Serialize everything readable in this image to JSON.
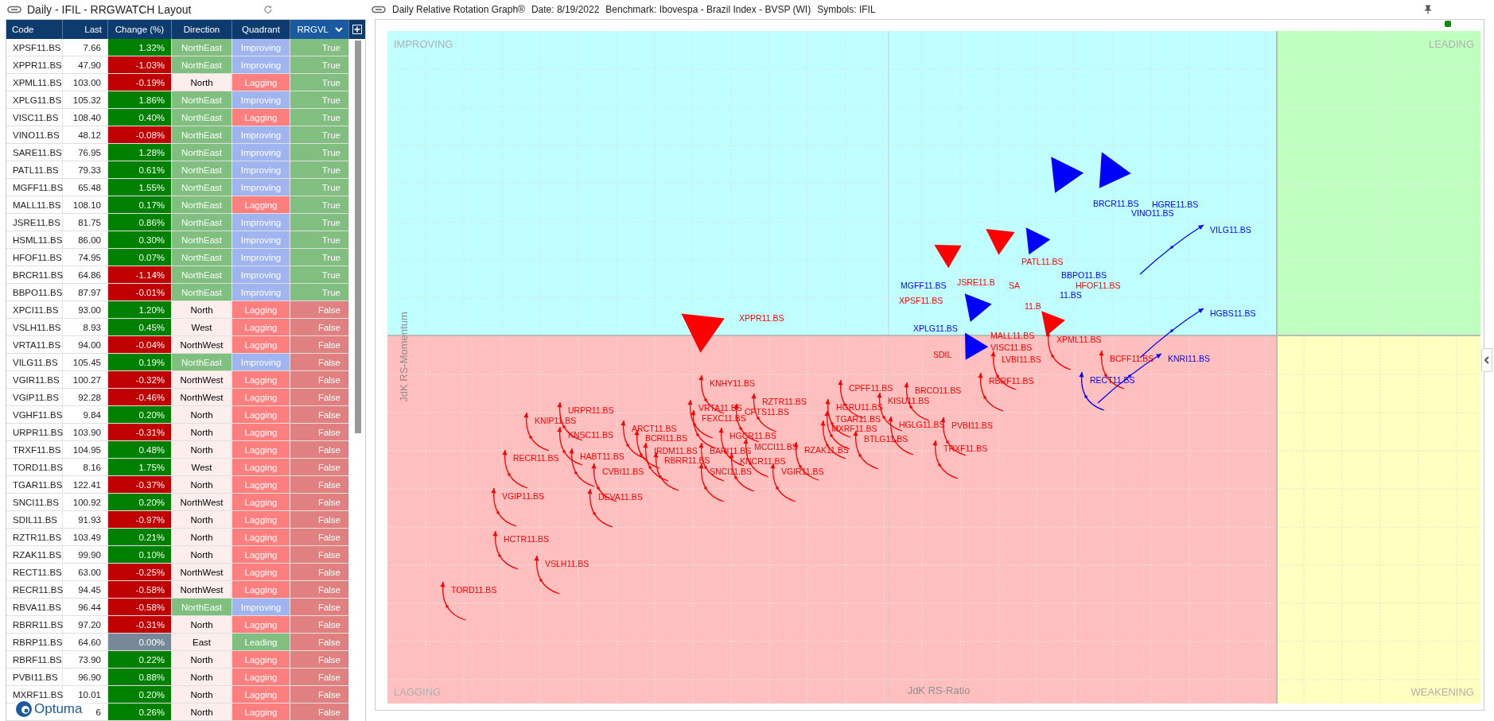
{
  "watchlist": {
    "title": "Daily - IFIL - RRGWATCH Layout",
    "columns": [
      "Code",
      "Last",
      "Change (%)",
      "Direction",
      "Quadrant",
      "RRGVL"
    ],
    "rows": [
      {
        "code": "XPSF11.BS",
        "last": "7.66",
        "change": {
          "text": "1.32%",
          "color": "#008000"
        },
        "direction": {
          "text": "NorthEast",
          "color": "#80bf80"
        },
        "quadrant": {
          "text": "Improving",
          "color": "#a0b4f0"
        },
        "rrgvl": {
          "text": "True",
          "color": "#80bf80"
        }
      },
      {
        "code": "XPPR11.BS",
        "last": "47.90",
        "change": {
          "text": "-1.03%",
          "color": "#c00000"
        },
        "direction": {
          "text": "NorthEast",
          "color": "#80bf80"
        },
        "quadrant": {
          "text": "Improving",
          "color": "#a0b4f0"
        },
        "rrgvl": {
          "text": "True",
          "color": "#80bf80"
        }
      },
      {
        "code": "XPML11.BS",
        "last": "103.00",
        "change": {
          "text": "-0.19%",
          "color": "#c00000"
        },
        "direction": {
          "text": "North",
          "color": "#fdeeee"
        },
        "quadrant": {
          "text": "Lagging",
          "color": "#ff7f7f"
        },
        "rrgvl": {
          "text": "True",
          "color": "#80bf80"
        }
      },
      {
        "code": "XPLG11.BS",
        "last": "105.32",
        "change": {
          "text": "1.86%",
          "color": "#008000"
        },
        "direction": {
          "text": "NorthEast",
          "color": "#80bf80"
        },
        "quadrant": {
          "text": "Improving",
          "color": "#a0b4f0"
        },
        "rrgvl": {
          "text": "True",
          "color": "#80bf80"
        }
      },
      {
        "code": "VISC11.BS",
        "last": "108.40",
        "change": {
          "text": "0.40%",
          "color": "#008000"
        },
        "direction": {
          "text": "NorthEast",
          "color": "#80bf80"
        },
        "quadrant": {
          "text": "Lagging",
          "color": "#ff7f7f"
        },
        "rrgvl": {
          "text": "True",
          "color": "#80bf80"
        }
      },
      {
        "code": "VINO11.BS",
        "last": "48.12",
        "change": {
          "text": "-0.08%",
          "color": "#c00000"
        },
        "direction": {
          "text": "NorthEast",
          "color": "#80bf80"
        },
        "quadrant": {
          "text": "Improving",
          "color": "#a0b4f0"
        },
        "rrgvl": {
          "text": "True",
          "color": "#80bf80"
        }
      },
      {
        "code": "SARE11.BS",
        "last": "76.95",
        "change": {
          "text": "1.28%",
          "color": "#008000"
        },
        "direction": {
          "text": "NorthEast",
          "color": "#80bf80"
        },
        "quadrant": {
          "text": "Improving",
          "color": "#a0b4f0"
        },
        "rrgvl": {
          "text": "True",
          "color": "#80bf80"
        }
      },
      {
        "code": "PATL11.BS",
        "last": "79.33",
        "change": {
          "text": "0.61%",
          "color": "#008000"
        },
        "direction": {
          "text": "NorthEast",
          "color": "#80bf80"
        },
        "quadrant": {
          "text": "Improving",
          "color": "#a0b4f0"
        },
        "rrgvl": {
          "text": "True",
          "color": "#80bf80"
        }
      },
      {
        "code": "MGFF11.BS",
        "last": "65.48",
        "change": {
          "text": "1.55%",
          "color": "#008000"
        },
        "direction": {
          "text": "NorthEast",
          "color": "#80bf80"
        },
        "quadrant": {
          "text": "Improving",
          "color": "#a0b4f0"
        },
        "rrgvl": {
          "text": "True",
          "color": "#80bf80"
        }
      },
      {
        "code": "MALL11.BS",
        "last": "108.10",
        "change": {
          "text": "0.17%",
          "color": "#008000"
        },
        "direction": {
          "text": "NorthEast",
          "color": "#80bf80"
        },
        "quadrant": {
          "text": "Lagging",
          "color": "#ff7f7f"
        },
        "rrgvl": {
          "text": "True",
          "color": "#80bf80"
        }
      },
      {
        "code": "JSRE11.BS",
        "last": "81.75",
        "change": {
          "text": "0.86%",
          "color": "#008000"
        },
        "direction": {
          "text": "NorthEast",
          "color": "#80bf80"
        },
        "quadrant": {
          "text": "Improving",
          "color": "#a0b4f0"
        },
        "rrgvl": {
          "text": "True",
          "color": "#80bf80"
        }
      },
      {
        "code": "HSML11.BS",
        "last": "86.00",
        "change": {
          "text": "0.30%",
          "color": "#008000"
        },
        "direction": {
          "text": "NorthEast",
          "color": "#80bf80"
        },
        "quadrant": {
          "text": "Improving",
          "color": "#a0b4f0"
        },
        "rrgvl": {
          "text": "True",
          "color": "#80bf80"
        }
      },
      {
        "code": "HFOF11.BS",
        "last": "74.95",
        "change": {
          "text": "0.07%",
          "color": "#008000"
        },
        "direction": {
          "text": "NorthEast",
          "color": "#80bf80"
        },
        "quadrant": {
          "text": "Improving",
          "color": "#a0b4f0"
        },
        "rrgvl": {
          "text": "True",
          "color": "#80bf80"
        }
      },
      {
        "code": "BRCR11.BS",
        "last": "64.86",
        "change": {
          "text": "-1.14%",
          "color": "#c00000"
        },
        "direction": {
          "text": "NorthEast",
          "color": "#80bf80"
        },
        "quadrant": {
          "text": "Improving",
          "color": "#a0b4f0"
        },
        "rrgvl": {
          "text": "True",
          "color": "#80bf80"
        }
      },
      {
        "code": "BBPO11.BS",
        "last": "87.97",
        "change": {
          "text": "-0.01%",
          "color": "#c00000"
        },
        "direction": {
          "text": "NorthEast",
          "color": "#80bf80"
        },
        "quadrant": {
          "text": "Improving",
          "color": "#a0b4f0"
        },
        "rrgvl": {
          "text": "True",
          "color": "#80bf80"
        }
      },
      {
        "code": "XPCI11.BS",
        "last": "93.00",
        "change": {
          "text": "1.20%",
          "color": "#008000"
        },
        "direction": {
          "text": "North",
          "color": "#fdeeee"
        },
        "quadrant": {
          "text": "Lagging",
          "color": "#ff7f7f"
        },
        "rrgvl": {
          "text": "False",
          "color": "#e08080"
        }
      },
      {
        "code": "VSLH11.BS",
        "last": "8.93",
        "change": {
          "text": "0.45%",
          "color": "#008000"
        },
        "direction": {
          "text": "West",
          "color": "#fdeeee"
        },
        "quadrant": {
          "text": "Lagging",
          "color": "#ff7f7f"
        },
        "rrgvl": {
          "text": "False",
          "color": "#e08080"
        }
      },
      {
        "code": "VRTA11.BS",
        "last": "94.00",
        "change": {
          "text": "-0.04%",
          "color": "#c00000"
        },
        "direction": {
          "text": "NorthWest",
          "color": "#fdeeee"
        },
        "quadrant": {
          "text": "Lagging",
          "color": "#ff7f7f"
        },
        "rrgvl": {
          "text": "False",
          "color": "#e08080"
        }
      },
      {
        "code": "VILG11.BS",
        "last": "105.45",
        "change": {
          "text": "0.19%",
          "color": "#008000"
        },
        "direction": {
          "text": "NorthEast",
          "color": "#80bf80"
        },
        "quadrant": {
          "text": "Improving",
          "color": "#a0b4f0"
        },
        "rrgvl": {
          "text": "False",
          "color": "#e08080"
        }
      },
      {
        "code": "VGIR11.BS",
        "last": "100.27",
        "change": {
          "text": "-0.32%",
          "color": "#c00000"
        },
        "direction": {
          "text": "NorthWest",
          "color": "#fdeeee"
        },
        "quadrant": {
          "text": "Lagging",
          "color": "#ff7f7f"
        },
        "rrgvl": {
          "text": "False",
          "color": "#e08080"
        }
      },
      {
        "code": "VGIP11.BS",
        "last": "92.28",
        "change": {
          "text": "-0.46%",
          "color": "#c00000"
        },
        "direction": {
          "text": "NorthWest",
          "color": "#fdeeee"
        },
        "quadrant": {
          "text": "Lagging",
          "color": "#ff7f7f"
        },
        "rrgvl": {
          "text": "False",
          "color": "#e08080"
        }
      },
      {
        "code": "VGHF11.BS",
        "last": "9.84",
        "change": {
          "text": "0.20%",
          "color": "#008000"
        },
        "direction": {
          "text": "North",
          "color": "#fdeeee"
        },
        "quadrant": {
          "text": "Lagging",
          "color": "#ff7f7f"
        },
        "rrgvl": {
          "text": "False",
          "color": "#e08080"
        }
      },
      {
        "code": "URPR11.BS",
        "last": "103.90",
        "change": {
          "text": "-0.31%",
          "color": "#c00000"
        },
        "direction": {
          "text": "North",
          "color": "#fdeeee"
        },
        "quadrant": {
          "text": "Lagging",
          "color": "#ff7f7f"
        },
        "rrgvl": {
          "text": "False",
          "color": "#e08080"
        }
      },
      {
        "code": "TRXF11.BS",
        "last": "104.95",
        "change": {
          "text": "0.48%",
          "color": "#008000"
        },
        "direction": {
          "text": "North",
          "color": "#fdeeee"
        },
        "quadrant": {
          "text": "Lagging",
          "color": "#ff7f7f"
        },
        "rrgvl": {
          "text": "False",
          "color": "#e08080"
        }
      },
      {
        "code": "TORD11.BS",
        "last": "8.16",
        "change": {
          "text": "1.75%",
          "color": "#008000"
        },
        "direction": {
          "text": "West",
          "color": "#fdeeee"
        },
        "quadrant": {
          "text": "Lagging",
          "color": "#ff7f7f"
        },
        "rrgvl": {
          "text": "False",
          "color": "#e08080"
        }
      },
      {
        "code": "TGAR11.BS",
        "last": "122.41",
        "change": {
          "text": "-0.37%",
          "color": "#c00000"
        },
        "direction": {
          "text": "North",
          "color": "#fdeeee"
        },
        "quadrant": {
          "text": "Lagging",
          "color": "#ff7f7f"
        },
        "rrgvl": {
          "text": "False",
          "color": "#e08080"
        }
      },
      {
        "code": "SNCI11.BS",
        "last": "100.92",
        "change": {
          "text": "0.20%",
          "color": "#008000"
        },
        "direction": {
          "text": "NorthWest",
          "color": "#fdeeee"
        },
        "quadrant": {
          "text": "Lagging",
          "color": "#ff7f7f"
        },
        "rrgvl": {
          "text": "False",
          "color": "#e08080"
        }
      },
      {
        "code": "SDIL11.BS",
        "last": "91.93",
        "change": {
          "text": "-0.97%",
          "color": "#c00000"
        },
        "direction": {
          "text": "North",
          "color": "#fdeeee"
        },
        "quadrant": {
          "text": "Lagging",
          "color": "#ff7f7f"
        },
        "rrgvl": {
          "text": "False",
          "color": "#e08080"
        }
      },
      {
        "code": "RZTR11.BS",
        "last": "103.49",
        "change": {
          "text": "0.21%",
          "color": "#008000"
        },
        "direction": {
          "text": "North",
          "color": "#fdeeee"
        },
        "quadrant": {
          "text": "Lagging",
          "color": "#ff7f7f"
        },
        "rrgvl": {
          "text": "False",
          "color": "#e08080"
        }
      },
      {
        "code": "RZAK11.BS",
        "last": "99.90",
        "change": {
          "text": "0.10%",
          "color": "#008000"
        },
        "direction": {
          "text": "North",
          "color": "#fdeeee"
        },
        "quadrant": {
          "text": "Lagging",
          "color": "#ff7f7f"
        },
        "rrgvl": {
          "text": "False",
          "color": "#e08080"
        }
      },
      {
        "code": "RECT11.BS",
        "last": "63.00",
        "change": {
          "text": "-0.25%",
          "color": "#c00000"
        },
        "direction": {
          "text": "NorthWest",
          "color": "#fdeeee"
        },
        "quadrant": {
          "text": "Lagging",
          "color": "#ff7f7f"
        },
        "rrgvl": {
          "text": "False",
          "color": "#e08080"
        }
      },
      {
        "code": "RECR11.BS",
        "last": "94.45",
        "change": {
          "text": "-0.58%",
          "color": "#c00000"
        },
        "direction": {
          "text": "NorthWest",
          "color": "#fdeeee"
        },
        "quadrant": {
          "text": "Lagging",
          "color": "#ff7f7f"
        },
        "rrgvl": {
          "text": "False",
          "color": "#e08080"
        }
      },
      {
        "code": "RBVA11.BS",
        "last": "96.44",
        "change": {
          "text": "-0.58%",
          "color": "#c00000"
        },
        "direction": {
          "text": "NorthEast",
          "color": "#80bf80"
        },
        "quadrant": {
          "text": "Improving",
          "color": "#a0b4f0"
        },
        "rrgvl": {
          "text": "False",
          "color": "#e08080"
        }
      },
      {
        "code": "RBRR11.BS",
        "last": "97.20",
        "change": {
          "text": "-0.31%",
          "color": "#c00000"
        },
        "direction": {
          "text": "North",
          "color": "#fdeeee"
        },
        "quadrant": {
          "text": "Lagging",
          "color": "#ff7f7f"
        },
        "rrgvl": {
          "text": "False",
          "color": "#e08080"
        }
      },
      {
        "code": "RBRP11.BS",
        "last": "64.60",
        "change": {
          "text": "0.00%",
          "color": "#778899"
        },
        "direction": {
          "text": "East",
          "color": "#fdeeee"
        },
        "quadrant": {
          "text": "Leading",
          "color": "#80bf80"
        },
        "rrgvl": {
          "text": "False",
          "color": "#e08080"
        }
      },
      {
        "code": "RBRF11.BS",
        "last": "73.90",
        "change": {
          "text": "0.22%",
          "color": "#008000"
        },
        "direction": {
          "text": "North",
          "color": "#fdeeee"
        },
        "quadrant": {
          "text": "Lagging",
          "color": "#ff7f7f"
        },
        "rrgvl": {
          "text": "False",
          "color": "#e08080"
        }
      },
      {
        "code": "PVBI11.BS",
        "last": "96.90",
        "change": {
          "text": "0.88%",
          "color": "#008000"
        },
        "direction": {
          "text": "North",
          "color": "#fdeeee"
        },
        "quadrant": {
          "text": "Lagging",
          "color": "#ff7f7f"
        },
        "rrgvl": {
          "text": "False",
          "color": "#e08080"
        }
      },
      {
        "code": "MXRF11.BS",
        "last": "10.01",
        "change": {
          "text": "0.20%",
          "color": "#008000"
        },
        "direction": {
          "text": "North",
          "color": "#fdeeee"
        },
        "quadrant": {
          "text": "Lagging",
          "color": "#ff7f7f"
        },
        "rrgvl": {
          "text": "False",
          "color": "#e08080"
        }
      },
      {
        "last": "6",
        "change": {
          "text": "0.26%",
          "color": "#008000"
        },
        "direction": {
          "text": "North",
          "color": "#fdeeee"
        },
        "quadrant": {
          "text": "Lagging",
          "color": "#ff7f7f"
        },
        "rrgvl": {
          "text": "False",
          "color": "#e08080"
        }
      }
    ],
    "logo": "Optuma"
  },
  "graph": {
    "title": "Daily Relative Rotation Graph®",
    "date": "Date: 8/19/2022",
    "benchmark": "Benchmark: Ibovespa - Brazil Index - BVSP (WI)",
    "symbols": "Symbols: IFIL",
    "quadrants": [
      "IMPROVING",
      "LEADING",
      "LAGGING",
      "WEAKENING"
    ],
    "y_axis": "JdK RS-Momentum",
    "x_axis": "JdK RS-Ratio",
    "labels": [
      {
        "text": "BRCR11.BS",
        "color": "#0000ff"
      },
      {
        "text": "HGRE11.BS",
        "color": "#0000ff"
      },
      {
        "text": "VINO11.BS",
        "color": "#0000ff"
      },
      {
        "text": "VILG11.BS",
        "color": "#0000ff"
      },
      {
        "text": "PATL11.BS",
        "color": "#ff0000"
      },
      {
        "text": "BBPO11.BS",
        "color": "#0000ff"
      },
      {
        "text": "MGFF11.BS",
        "color": "#0000ff"
      },
      {
        "text": "JSRE11.B",
        "color": "#ff0000"
      },
      {
        "text": "SA",
        "color": "#ff0000"
      },
      {
        "text": "HFOF11.BS",
        "color": "#ff0000"
      },
      {
        "text": "XPSF11.BS",
        "color": "#ff0000"
      },
      {
        "text": "11.BS",
        "color": "#0000ff"
      },
      {
        "text": "11.B",
        "color": "#ff0000"
      },
      {
        "text": "XPPR11.BS",
        "color": "#ff0000"
      },
      {
        "text": "HGBS11.BS",
        "color": "#0000ff"
      },
      {
        "text": "XPLG11.BS",
        "color": "#0000ff"
      },
      {
        "text": "MALL11.BS",
        "color": "#ff0000"
      },
      {
        "text": "XPML11.BS",
        "color": "#ff0000"
      },
      {
        "text": "VISC11.BS",
        "color": "#ff0000"
      },
      {
        "text": "SDIL",
        "color": "#ff0000"
      },
      {
        "text": "LVBI11.BS",
        "color": "#ff0000"
      },
      {
        "text": "BCFF11.BS",
        "color": "#ff0000"
      },
      {
        "text": "KNRI11.BS",
        "color": "#0000ff"
      },
      {
        "text": "KNHY11.BS",
        "color": "#ff0000"
      },
      {
        "text": "CPFF11.BS",
        "color": "#ff0000"
      },
      {
        "text": "BRCO11.BS",
        "color": "#ff0000"
      },
      {
        "text": "RBRF11.BS",
        "color": "#ff0000"
      },
      {
        "text": "RECT11.BS",
        "color": "#0000ff"
      },
      {
        "text": "RZTR11.BS",
        "color": "#ff0000"
      },
      {
        "text": "KISU11.BS",
        "color": "#ff0000"
      },
      {
        "text": "URPR11.BS",
        "color": "#ff0000"
      },
      {
        "text": "VRTA11.BS",
        "color": "#ff0000"
      },
      {
        "text": "CPTS11.BS",
        "color": "#ff0000"
      },
      {
        "text": "HGRU11.BS",
        "color": "#ff0000"
      },
      {
        "text": "KNIP11.BS",
        "color": "#ff0000"
      },
      {
        "text": "FEXC11.BS",
        "color": "#ff0000"
      },
      {
        "text": "TGAR11.BS",
        "color": "#ff0000"
      },
      {
        "text": "HGLG11.BS",
        "color": "#ff0000"
      },
      {
        "text": "PVBI11.BS",
        "color": "#ff0000"
      },
      {
        "text": "ARCT11.BS",
        "color": "#ff0000"
      },
      {
        "text": "MXRF11.BS",
        "color": "#ff0000"
      },
      {
        "text": "KNSC11.BS",
        "color": "#ff0000"
      },
      {
        "text": "BCRI11.BS",
        "color": "#ff0000"
      },
      {
        "text": "HGCR11.BS",
        "color": "#ff0000"
      },
      {
        "text": "BTLG11.BS",
        "color": "#ff0000"
      },
      {
        "text": "IRDM11.BS",
        "color": "#ff0000"
      },
      {
        "text": "BARI11.BS",
        "color": "#ff0000"
      },
      {
        "text": "MCCI11.BS",
        "color": "#ff0000"
      },
      {
        "text": "RZAK11.BS",
        "color": "#ff0000"
      },
      {
        "text": "TRXF11.BS",
        "color": "#ff0000"
      },
      {
        "text": "RECR11.BS",
        "color": "#ff0000"
      },
      {
        "text": "HABT11.BS",
        "color": "#ff0000"
      },
      {
        "text": "RBRR11.BS",
        "color": "#ff0000"
      },
      {
        "text": "KNCR11.BS",
        "color": "#ff0000"
      },
      {
        "text": "CVBI11.BS",
        "color": "#ff0000"
      },
      {
        "text": "SNCI11.BS",
        "color": "#ff0000"
      },
      {
        "text": "VGIR11.BS",
        "color": "#ff0000"
      },
      {
        "text": "VGIP11.BS",
        "color": "#ff0000"
      },
      {
        "text": "DEVA11.BS",
        "color": "#ff0000"
      },
      {
        "text": "HCTR11.BS",
        "color": "#ff0000"
      },
      {
        "text": "VSLH11.BS",
        "color": "#ff0000"
      },
      {
        "text": "TORD11.BS",
        "color": "#ff0000"
      }
    ]
  }
}
